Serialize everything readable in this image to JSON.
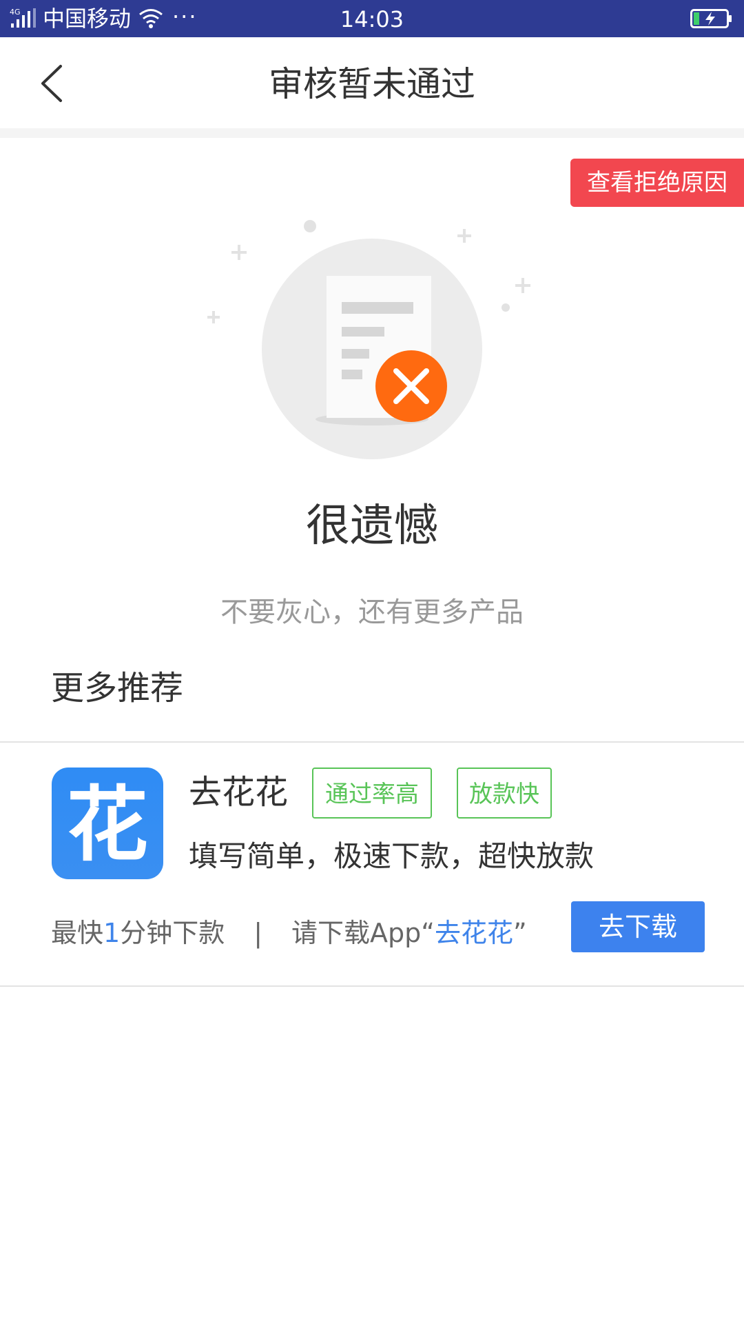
{
  "status_bar": {
    "network": "4G",
    "carrier": "中国移动",
    "more": "···",
    "time": "14:03"
  },
  "nav": {
    "title": "审核暂未通过"
  },
  "reason_button": "查看拒绝原因",
  "result": {
    "headline": "很遗憾",
    "subtitle": "不要灰心，还有更多产品"
  },
  "recommend": {
    "section_title": "更多推荐",
    "items": [
      {
        "icon_char": "花",
        "name": "去花花",
        "tags": [
          "通过率高",
          "放款快"
        ],
        "description": "填写简单，极速下款，超快放款",
        "meta": {
          "prefix": "最快",
          "highlight_number": "1",
          "suffix": "分钟下款",
          "separator": "|",
          "download_prefix": "请下载App“",
          "download_app": "去花花",
          "download_suffix": "”"
        },
        "button": "去下载"
      }
    ]
  },
  "colors": {
    "status_bar": "#2e3b93",
    "reject_button": "#f2474f",
    "tag_green": "#58c457",
    "primary_blue": "#3d82ee",
    "error_orange": "#ff6a10"
  }
}
